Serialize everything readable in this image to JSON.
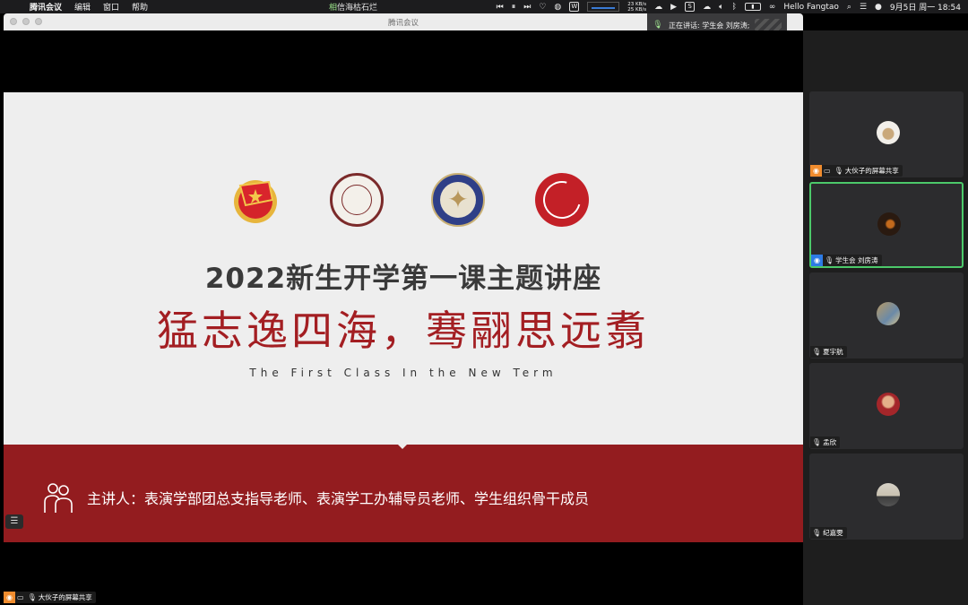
{
  "menubar": {
    "app": "腾讯会议",
    "items": [
      "编辑",
      "窗口",
      "帮助"
    ],
    "song_prefix": "相",
    "song_rest": "信海枯石烂",
    "net_up": "23 KB/s",
    "net_down": "25 KB/s",
    "greeting": "Hello Fangtao",
    "datetime": "9月5日 周一  18:54"
  },
  "window": {
    "title": "腾讯会议",
    "speaking": "正在讲话: 学生会 刘房涛;"
  },
  "slide": {
    "title": "2022新生开学第一课主题讲座",
    "subtitle": "猛志逸四海，骞翮思远翥",
    "english": "The First Class In the New Term",
    "speakers": "主讲人：表演学部团总支指导老师、表演学工办辅导员老师、学生组织骨干成员"
  },
  "stage_tag": "大伙子的屏幕共享",
  "participants": [
    {
      "name": "大伙子的屏幕共享",
      "active": false
    },
    {
      "name": "学生会 刘房涛",
      "active": true
    },
    {
      "name": "夏宇航",
      "active": false
    },
    {
      "name": "孟欣",
      "active": false
    },
    {
      "name": "纪嘉雯",
      "active": false
    }
  ],
  "icons": {
    "apple": "apple-icon",
    "mic": "microphone-icon",
    "share": "screen-share-icon",
    "list": "list-icon",
    "people": "people-icon"
  },
  "colors": {
    "slide_red": "#a31e22",
    "band_red": "#931c1f",
    "active_border": "#4cc96a",
    "avatar_orange": "#f08c2e",
    "avatar_blue": "#2d7be5"
  }
}
